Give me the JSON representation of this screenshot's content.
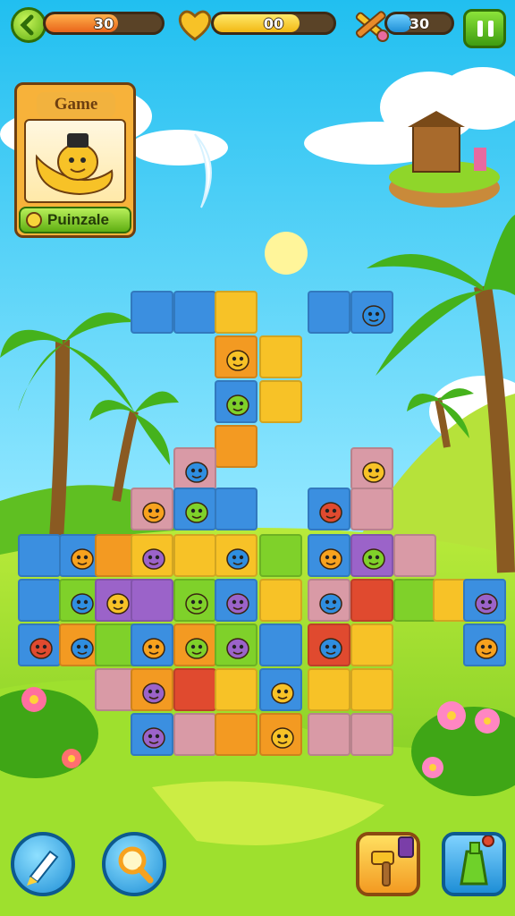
{
  "hud": {
    "lives_value": "30",
    "lives_fill": 0.62,
    "hearts_value": "00",
    "hearts_fill": 0.72,
    "tools_value": "30",
    "tools_fill": 0.38
  },
  "card": {
    "title": "Game",
    "button_label": "Puinzale"
  },
  "colors": {
    "sky_top": "#33c7f2",
    "grass": "#8fd62a",
    "tile_blue": "#3b8fe0",
    "tile_yellow": "#f7c227",
    "tile_orange": "#f39a22",
    "tile_green": "#7fd12a",
    "tile_purple": "#9b63c9",
    "tile_pink": "#d99aa6",
    "tile_red": "#e04a2f"
  },
  "bottom_buttons": {
    "brush": "paintbrush-icon",
    "magnifier": "magnifier-icon",
    "hammer": "hammer-icon",
    "bottle": "bottle-icon"
  }
}
